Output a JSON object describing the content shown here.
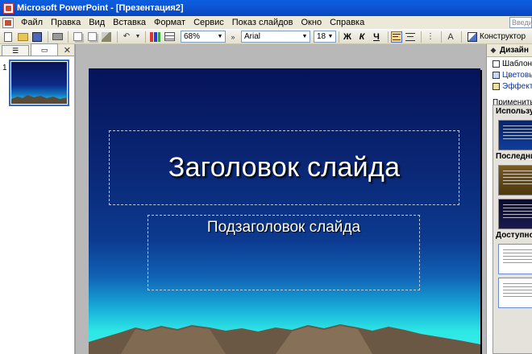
{
  "window": {
    "title": "Microsoft PowerPoint - [Презентация2]"
  },
  "menu": {
    "items": [
      "Файл",
      "Правка",
      "Вид",
      "Вставка",
      "Формат",
      "Сервис",
      "Показ слайдов",
      "Окно",
      "Справка"
    ],
    "help_placeholder": "Введите"
  },
  "toolbar": {
    "zoom": "68%",
    "font": "Arial",
    "font_size": "18",
    "bold": "Ж",
    "italic": "К",
    "underline": "Ч",
    "designer_label": "Конструктор"
  },
  "slides_pane": {
    "slide_number": "1"
  },
  "slide": {
    "title_placeholder": "Заголовок слайда",
    "subtitle_placeholder": "Подзаголовок слайда"
  },
  "task_pane": {
    "title": "Дизайн",
    "links": [
      {
        "label": "Шаблоны"
      },
      {
        "label": "Цветовые"
      },
      {
        "label": "Эффекты"
      }
    ],
    "apply_label": "Применить",
    "sections": [
      "Используется в презентации",
      "Последние использованные",
      "Доступно для использования"
    ]
  },
  "colors": {
    "titlebar": "#0A5FE0",
    "slide_top": "#06135A",
    "slide_bottom": "#3AF0EC",
    "selection": "#316AC5"
  }
}
